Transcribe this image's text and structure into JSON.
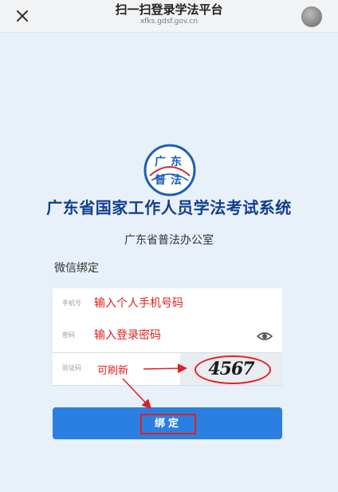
{
  "header": {
    "title": "扫一扫登录学法平台",
    "domain": "xfks.gdsf.gov.cn"
  },
  "emblem": {
    "characters": [
      "广",
      "东",
      "普",
      "法"
    ]
  },
  "brand": {
    "org_title": "广东省国家工作人员学法考试系统",
    "office": "广东省普法办公室"
  },
  "form": {
    "section_label": "微信绑定",
    "phone": {
      "label": "手机号",
      "placeholder": "输入个人手机号码"
    },
    "password": {
      "label": "密码",
      "placeholder": "输入登录密码"
    },
    "captcha": {
      "label": "验证码",
      "image_text": "4567",
      "note": "可刷新"
    },
    "submit_label": "绑定"
  },
  "colors": {
    "accent": "#2b7fe0",
    "annotation": "#e02020",
    "title": "#123f8a",
    "background": "#e8f0f9"
  },
  "icons": {
    "close": "close-icon",
    "eye": "eye-icon"
  }
}
